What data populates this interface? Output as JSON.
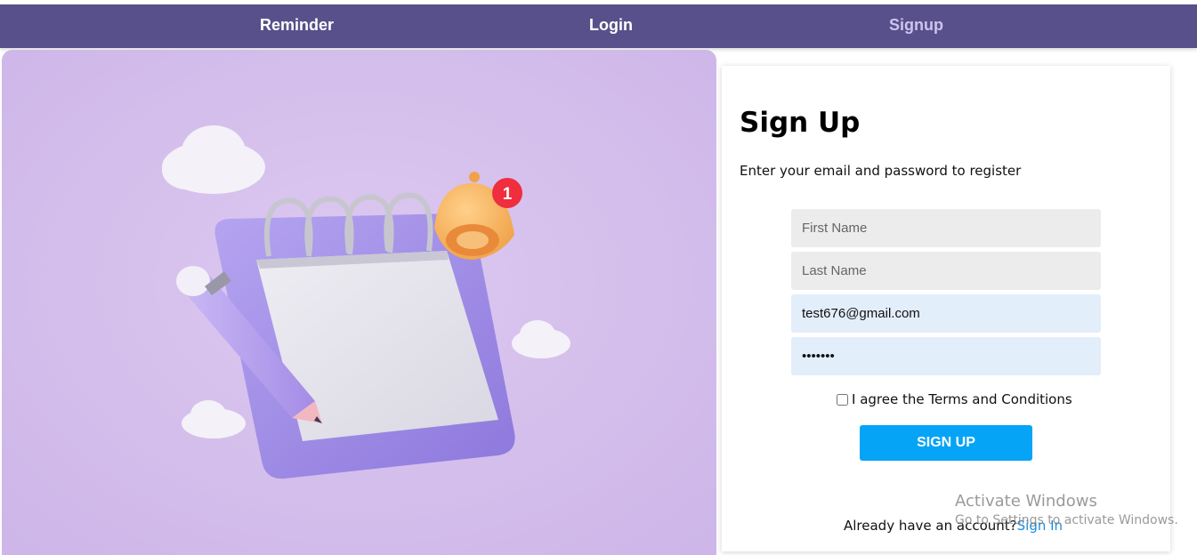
{
  "nav": {
    "brand": "Reminder",
    "login": "Login",
    "signup": "Signup"
  },
  "illustration": {
    "notification_count": "1"
  },
  "signup_form": {
    "title": "Sign Up",
    "subtitle": "Enter your email and password to register",
    "first_name_placeholder": "First Name",
    "last_name_placeholder": "Last Name",
    "email_value": "test676@gmail.com",
    "password_value": "1234567",
    "terms_label": "I agree the Terms and Conditions",
    "terms_checked": false,
    "submit_label": "SIGN UP",
    "already_text": "Already have an account?",
    "signin_link": "Sign In"
  },
  "watermark": {
    "title": "Activate Windows",
    "subtitle": "Go to Settings to activate Windows."
  },
  "colors": {
    "navbar": "#58508a",
    "accent_button": "#05a4f6",
    "link": "#1a8de0",
    "illustration_bg": "#d6c1ec"
  }
}
